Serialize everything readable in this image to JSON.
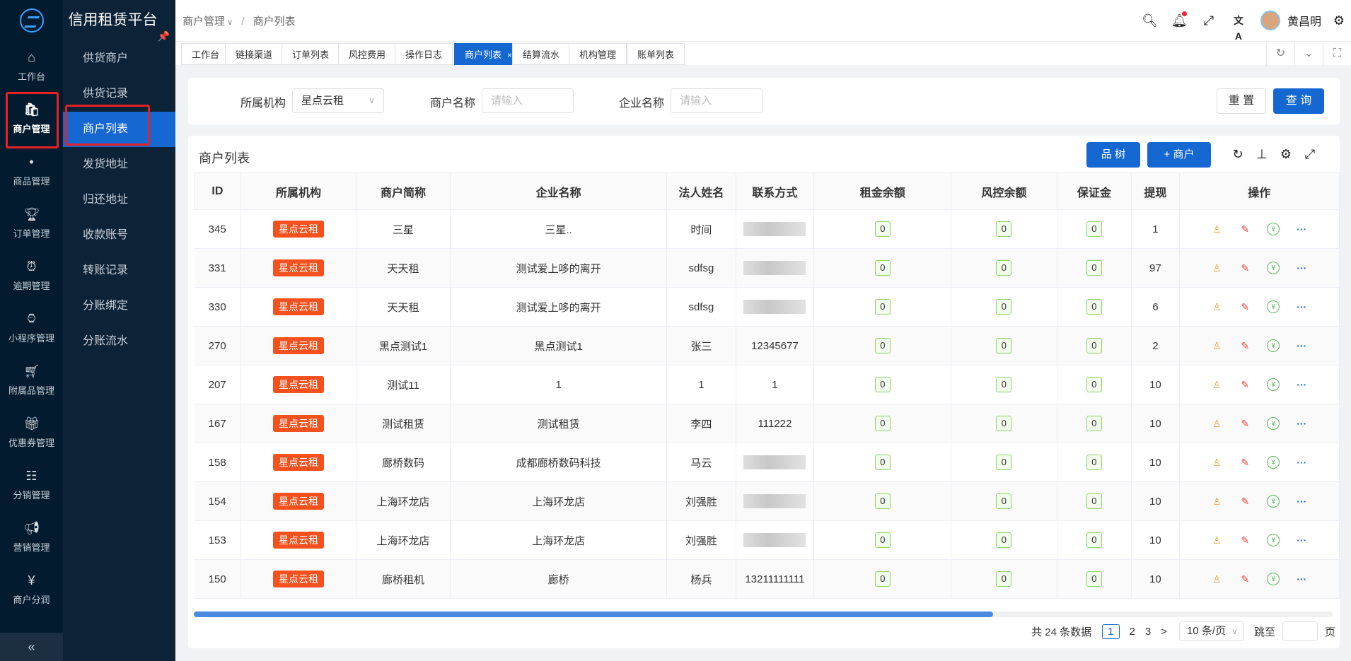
{
  "app": {
    "title": "信用租赁平台"
  },
  "rail": [
    {
      "label": "工作台",
      "icon": "home-icon"
    },
    {
      "label": "商户管理",
      "icon": "bag-icon",
      "active": true
    },
    {
      "label": "商品管理",
      "icon": "apple-icon"
    },
    {
      "label": "订单管理",
      "icon": "trophy-icon"
    },
    {
      "label": "逾期管理",
      "icon": "alarm-icon"
    },
    {
      "label": "小程序管理",
      "icon": "watch-icon"
    },
    {
      "label": "附属品管理",
      "icon": "cart-icon"
    },
    {
      "label": "优惠券管理",
      "icon": "gift-icon"
    },
    {
      "label": "分销管理",
      "icon": "sliders-icon"
    },
    {
      "label": "营销管理",
      "icon": "megaphone-icon"
    },
    {
      "label": "商户分润",
      "icon": "yen-icon"
    }
  ],
  "submenu": [
    {
      "label": "供货商户"
    },
    {
      "label": "供货记录"
    },
    {
      "label": "商户列表",
      "active": true
    },
    {
      "label": "发货地址"
    },
    {
      "label": "归还地址"
    },
    {
      "label": "收款账号"
    },
    {
      "label": "转账记录"
    },
    {
      "label": "分账绑定"
    },
    {
      "label": "分账流水"
    }
  ],
  "breadcrumb": {
    "parent": "商户管理",
    "current": "商户列表"
  },
  "user": {
    "name": "黄昌明"
  },
  "tabs": [
    {
      "label": "工作台"
    },
    {
      "label": "链接渠道"
    },
    {
      "label": "订单列表"
    },
    {
      "label": "风控费用"
    },
    {
      "label": "操作日志"
    },
    {
      "label": "商户列表",
      "active": true
    },
    {
      "label": "结算流水"
    },
    {
      "label": "机构管理"
    },
    {
      "label": "账单列表"
    }
  ],
  "search": {
    "org_label": "所属机构",
    "org_value": "星点云租",
    "merchant_label": "商户名称",
    "merchant_placeholder": "请输入",
    "company_label": "企业名称",
    "company_placeholder": "请输入",
    "reset": "重 置",
    "query": "查 询"
  },
  "list": {
    "title": "商户列表",
    "tree_btn": "树",
    "add_btn": "+ 商户",
    "columns": [
      "ID",
      "所属机构",
      "商户简称",
      "企业名称",
      "法人姓名",
      "联系方式",
      "租金余额",
      "风控余额",
      "保证金",
      "提现",
      "操作"
    ],
    "rows": [
      {
        "id": "345",
        "org": "星点云租",
        "short": "三星",
        "company": "三星..",
        "legal": "时间",
        "contact": "",
        "masked": true,
        "rent": "0",
        "risk": "0",
        "deposit": "0",
        "withdraw": "1"
      },
      {
        "id": "331",
        "org": "星点云租",
        "short": "天天租",
        "company": "测试爱上哆的离开",
        "legal": "sdfsg",
        "contact": "",
        "masked": true,
        "rent": "0",
        "risk": "0",
        "deposit": "0",
        "withdraw": "97"
      },
      {
        "id": "330",
        "org": "星点云租",
        "short": "天天租",
        "company": "测试爱上哆的离开",
        "legal": "sdfsg",
        "contact": "",
        "masked": true,
        "rent": "0",
        "risk": "0",
        "deposit": "0",
        "withdraw": "6"
      },
      {
        "id": "270",
        "org": "星点云租",
        "short": "黑点测试1",
        "company": "黑点测试1",
        "legal": "张三",
        "contact": "12345677",
        "masked": false,
        "rent": "0",
        "risk": "0",
        "deposit": "0",
        "withdraw": "2"
      },
      {
        "id": "207",
        "org": "星点云租",
        "short": "测试11",
        "company": "1",
        "legal": "1",
        "contact": "1",
        "masked": false,
        "rent": "0",
        "risk": "0",
        "deposit": "0",
        "withdraw": "10"
      },
      {
        "id": "167",
        "org": "星点云租",
        "short": "测试租赁",
        "company": "测试租赁",
        "legal": "李四",
        "contact": "111222",
        "masked": false,
        "rent": "0",
        "risk": "0",
        "deposit": "0",
        "withdraw": "10"
      },
      {
        "id": "158",
        "org": "星点云租",
        "short": "廊桥数码",
        "company": "成都廊桥数码科技",
        "legal": "马云",
        "contact": "",
        "masked": true,
        "rent": "0",
        "risk": "0",
        "deposit": "0",
        "withdraw": "10"
      },
      {
        "id": "154",
        "org": "星点云租",
        "short": "上海环龙店",
        "company": "上海环龙店",
        "legal": "刘强胜",
        "contact": "",
        "masked": true,
        "rent": "0",
        "risk": "0",
        "deposit": "0",
        "withdraw": "10"
      },
      {
        "id": "153",
        "org": "星点云租",
        "short": "上海环龙店",
        "company": "上海环龙店",
        "legal": "刘强胜",
        "contact": "",
        "masked": true,
        "rent": "0",
        "risk": "0",
        "deposit": "0",
        "withdraw": "10"
      },
      {
        "id": "150",
        "org": "星点云租",
        "short": "廊桥租机",
        "company": "廊桥",
        "legal": "杨兵",
        "contact": "13211111111",
        "masked": false,
        "rent": "0",
        "risk": "0",
        "deposit": "0",
        "withdraw": "10"
      }
    ]
  },
  "pagination": {
    "total": "共 24 条数据",
    "pages": [
      "1",
      "2",
      "3"
    ],
    "next": ">",
    "size": "10 条/页",
    "jump_label": "跳至",
    "jump_suffix": "页"
  },
  "colors": {
    "primary": "#1567d2",
    "sidebar": "#021b2e",
    "tag": "#f4511e",
    "highlight": "#e52121"
  }
}
